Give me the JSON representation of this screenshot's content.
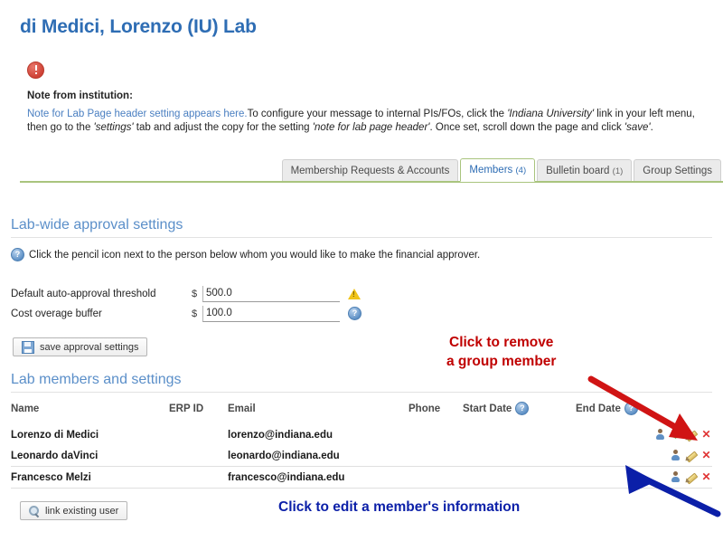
{
  "page": {
    "title": "di Medici, Lorenzo (IU) Lab"
  },
  "note": {
    "icon": "alert-circle-icon",
    "label": "Note from institution:",
    "link_text": "Note for Lab Page header setting appears here.",
    "body_part1": "To configure your message to internal PIs/FOs, click the ",
    "body_em1": "'Indiana University'",
    "body_part2": " link in your left menu, then go to the ",
    "body_em2": "'settings'",
    "body_part3": " tab and adjust the copy for the setting ",
    "body_em3": "'note for lab page header'",
    "body_part4": ". Once set, scroll down the page and click ",
    "body_em4": "'save'",
    "body_part5": "."
  },
  "tabs": [
    {
      "label": "Membership Requests & Accounts",
      "count": "",
      "active": false
    },
    {
      "label": "Members",
      "count": "(4)",
      "active": true
    },
    {
      "label": "Bulletin board",
      "count": "(1)",
      "active": false
    },
    {
      "label": "Group Settings",
      "count": "",
      "active": false
    }
  ],
  "approval": {
    "heading": "Lab-wide approval settings",
    "hint": "Click the pencil icon next to the person below whom you would like to make the financial approver.",
    "rows": [
      {
        "label": "Default auto-approval threshold",
        "currency": "$",
        "value": "500.0",
        "trailing_icon": "warning-icon"
      },
      {
        "label": "Cost overage buffer",
        "currency": "$",
        "value": "100.0",
        "trailing_icon": "help-icon"
      }
    ],
    "save_label": "save approval settings"
  },
  "members": {
    "heading": "Lab members and settings",
    "columns": [
      "Name",
      "ERP ID",
      "Email",
      "Phone",
      "Start Date",
      "End Date",
      ""
    ],
    "columns_help": [
      false,
      false,
      false,
      false,
      true,
      true,
      false
    ],
    "rows": [
      {
        "name": "Lorenzo di Medici",
        "erp_id": "",
        "email": "lorenzo@indiana.edu",
        "phone": "",
        "start_date": "",
        "end_date": "",
        "actions": [
          "person-icon",
          "money-icon",
          "pencil-icon",
          "remove-icon"
        ]
      },
      {
        "name": "Leonardo daVinci",
        "erp_id": "",
        "email": "leonardo@indiana.edu",
        "phone": "",
        "start_date": "",
        "end_date": "",
        "actions": [
          "person-icon",
          "pencil-icon",
          "remove-icon"
        ]
      },
      {
        "name": "Francesco Melzi",
        "erp_id": "",
        "email": "francesco@indiana.edu",
        "phone": "",
        "start_date": "",
        "end_date": "",
        "actions": [
          "person-icon",
          "pencil-icon",
          "remove-icon"
        ]
      }
    ],
    "link_user_label": "link existing user"
  },
  "annotations": [
    {
      "text": "Click to remove\na group member",
      "color": "#c00000"
    },
    {
      "text": "Click to edit a member's information",
      "color": "#0b1fa8"
    }
  ],
  "colors": {
    "heading_blue": "#5b8fc9",
    "title_blue": "#2e6db4",
    "tab_green": "#a9c47e",
    "annotation_red": "#c00000",
    "annotation_blue": "#0b1fa8"
  }
}
